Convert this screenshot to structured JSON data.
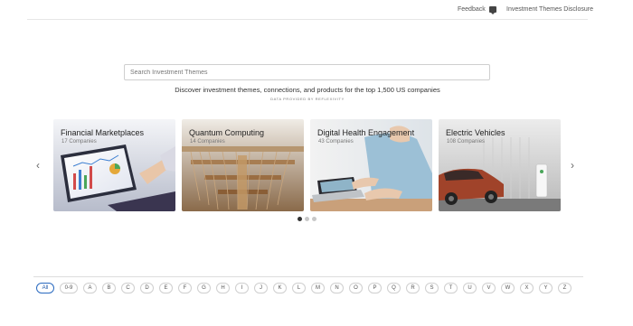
{
  "header": {
    "feedback_label": "Feedback",
    "feedback_icon": "comment-icon",
    "disclosure_label": "Investment Themes Disclosure"
  },
  "search": {
    "placeholder": "Search Investment Themes",
    "tagline": "Discover investment themes, connections, and products for the top 1,500 US companies",
    "provider": "DATA PROVIDED BY REFLEXIVITY"
  },
  "carousel": {
    "prev_icon": "chevron-left-icon",
    "next_icon": "chevron-right-icon",
    "cards": [
      {
        "title": "Financial Marketplaces",
        "count": "17 Companies"
      },
      {
        "title": "Quantum Computing",
        "count": "14 Companies"
      },
      {
        "title": "Digital Health Engagement",
        "count": "43 Companies"
      },
      {
        "title": "Electric Vehicles",
        "count": "108 Companies"
      }
    ],
    "active_page": 1,
    "page_count": 3
  },
  "alphabet": [
    "All",
    "0-9",
    "A",
    "B",
    "C",
    "D",
    "E",
    "F",
    "G",
    "H",
    "I",
    "J",
    "K",
    "L",
    "M",
    "N",
    "O",
    "P",
    "Q",
    "R",
    "S",
    "T",
    "U",
    "V",
    "W",
    "X",
    "Y",
    "Z"
  ],
  "selected_letter": "All",
  "colors": {
    "accent": "#2a6ac0",
    "divider": "#e6e6e6"
  }
}
